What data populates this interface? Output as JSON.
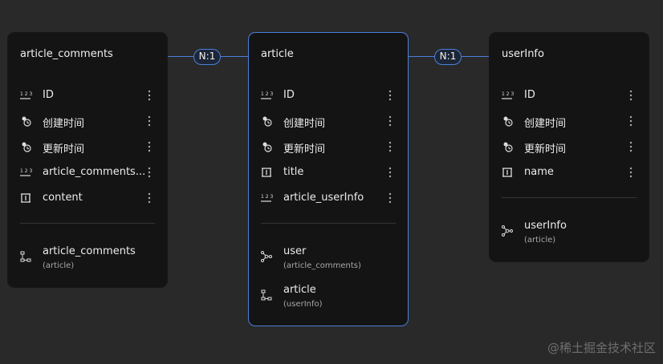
{
  "relations": [
    {
      "label": "N:1"
    },
    {
      "label": "N:1"
    }
  ],
  "entities": [
    {
      "title": "article_comments",
      "fields": [
        {
          "name": "ID",
          "icon": "number-icon"
        },
        {
          "name": "创建时间",
          "icon": "datetime-icon"
        },
        {
          "name": "更新时间",
          "icon": "datetime-icon"
        },
        {
          "name": "article_comments...",
          "icon": "number-icon"
        },
        {
          "name": "content",
          "icon": "text-icon"
        }
      ],
      "relations": [
        {
          "name": "article_comments",
          "sub": "(article)",
          "icon": "relation-icon"
        }
      ]
    },
    {
      "title": "article",
      "fields": [
        {
          "name": "ID",
          "icon": "number-icon"
        },
        {
          "name": "创建时间",
          "icon": "datetime-icon"
        },
        {
          "name": "更新时间",
          "icon": "datetime-icon"
        },
        {
          "name": "title",
          "icon": "text-icon"
        },
        {
          "name": "article_userInfo",
          "icon": "number-icon"
        }
      ],
      "relations": [
        {
          "name": "user",
          "sub": "(article_comments)",
          "icon": "relation-many-icon"
        },
        {
          "name": "article",
          "sub": "(userInfo)",
          "icon": "relation-icon"
        }
      ]
    },
    {
      "title": "userInfo",
      "fields": [
        {
          "name": "ID",
          "icon": "number-icon"
        },
        {
          "name": "创建时间",
          "icon": "datetime-icon"
        },
        {
          "name": "更新时间",
          "icon": "datetime-icon"
        },
        {
          "name": "name",
          "icon": "text-icon"
        }
      ],
      "relations": [
        {
          "name": "userInfo",
          "sub": "(article)",
          "icon": "relation-many-icon"
        }
      ]
    }
  ],
  "watermark": "@稀土掘金技术社区",
  "colors": {
    "accent": "#4a7fdc",
    "background": "#292929",
    "card": "#141414"
  }
}
